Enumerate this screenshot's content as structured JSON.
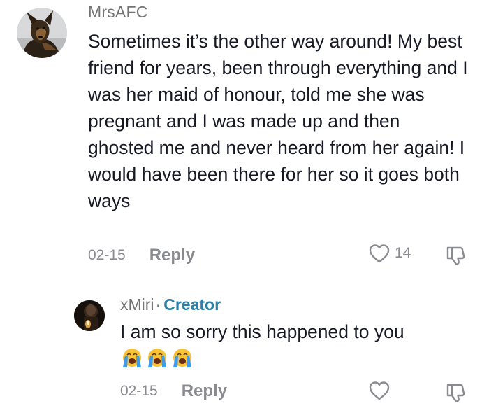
{
  "comment": {
    "username": "MrsAFC",
    "text": "Sometimes it’s the other way around! My best friend for years, been through everything and I was her maid of honour, told me she was pregnant and I was made up and then ghosted me and never heard from her again! I would have been there for her so it goes both ways",
    "date": "02-15",
    "reply_label": "Reply",
    "like_count": "14",
    "avatar_icon": "dog-avatar"
  },
  "reply": {
    "username": "xMiri",
    "separator": "·",
    "badge": "Creator",
    "text": "I am so sorry this happened to you",
    "emojis": [
      "loudly-crying-face",
      "loudly-crying-face",
      "loudly-crying-face"
    ],
    "date": "02-15",
    "reply_label": "Reply",
    "avatar_icon": "candle-avatar"
  },
  "colors": {
    "muted": "#8a8b91",
    "text": "#161823",
    "creator": "#2b7fa8"
  }
}
